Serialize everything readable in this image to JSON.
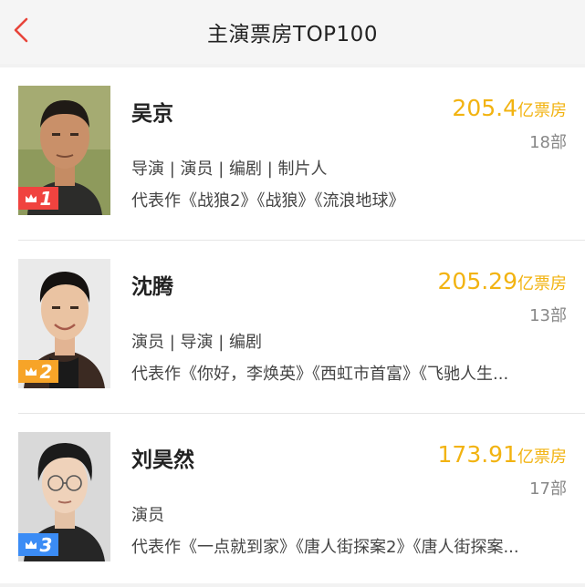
{
  "header": {
    "title": "主演票房TOP100"
  },
  "colors": {
    "accent_gold": "#f2b311",
    "back_red": "#e8443a",
    "badge_red": "#f0433f",
    "badge_orange": "#f7a428",
    "badge_blue": "#3b8cf5"
  },
  "actors": [
    {
      "rank": "1",
      "name": "吴京",
      "box_office": "205.4",
      "box_unit": "亿票房",
      "film_count": "18部",
      "roles": "导演 | 演员 | 编剧 | 制片人",
      "works": "代表作《战狼2》《战狼》《流浪地球》"
    },
    {
      "rank": "2",
      "name": "沈腾",
      "box_office": "205.29",
      "box_unit": "亿票房",
      "film_count": "13部",
      "roles": "演员 | 导演 | 编剧",
      "works": "代表作《你好，李焕英》《西虹市首富》《飞驰人生..."
    },
    {
      "rank": "3",
      "name": "刘昊然",
      "box_office": "173.91",
      "box_unit": "亿票房",
      "film_count": "17部",
      "roles": "演员",
      "works": "代表作《一点就到家》《唐人街探案2》《唐人街探案..."
    }
  ]
}
